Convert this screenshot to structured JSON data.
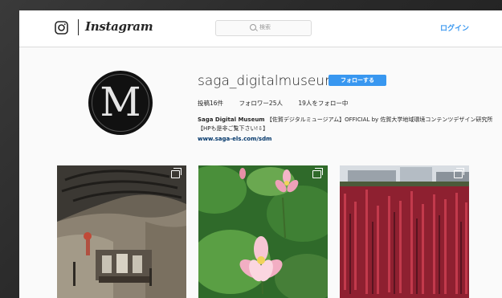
{
  "header": {
    "brand": "Instagram",
    "search_placeholder": "検索",
    "login_label": "ログイン"
  },
  "profile": {
    "avatar_letter": "M",
    "username": "saga_digitalmuseum",
    "follow_label": "フォローする",
    "stats": {
      "posts": "投稿16件",
      "followers": "フォロワー25人",
      "following": "19人をフォロー中"
    },
    "bio_name": "Saga Digital Museum",
    "bio_text": "【佐賀デジタルミュージアム】OFFICIAL by 佐賀大学地域環境コンテンツデザイン研究所 【HPも是非ご覧下さい!⇩】",
    "website": "www.saga-els.com/sdm"
  },
  "posts": [
    {
      "label": "cave-shrine-photo"
    },
    {
      "label": "lotus-flower-photo"
    },
    {
      "label": "red-flower-field-photo"
    }
  ],
  "colors": {
    "accent": "#3897f0",
    "link": "#003569",
    "text": "#262626",
    "background": "#fafafa"
  }
}
